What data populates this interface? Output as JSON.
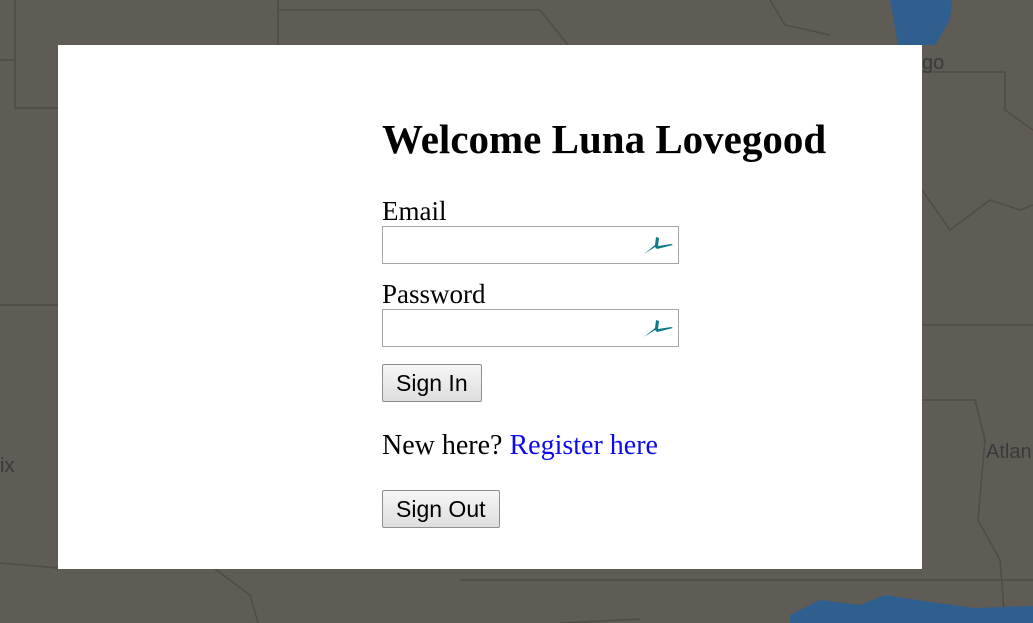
{
  "backdrop": {
    "map_labels": [
      "go",
      "ix",
      "Atlan"
    ]
  },
  "modal": {
    "title": "Welcome Luna Lovegood",
    "email": {
      "label": "Email",
      "value": "",
      "icon": "autofill-icon"
    },
    "password": {
      "label": "Password",
      "value": "",
      "icon": "autofill-icon"
    },
    "sign_in_label": "Sign In",
    "register_prompt": "New here?",
    "register_link": "Register here",
    "sign_out_label": "Sign Out"
  },
  "colors": {
    "backdrop": "#5f5b55",
    "water": "#2f5f8f",
    "link": "#0b0bee",
    "icon": "#0e7c86"
  }
}
